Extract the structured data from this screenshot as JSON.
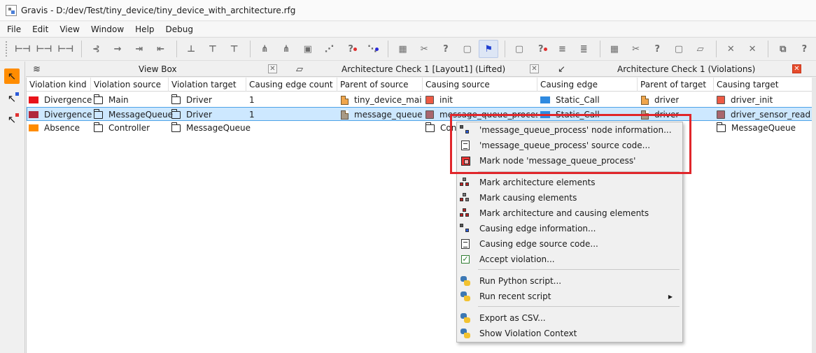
{
  "window": {
    "title": "Gravis - D:/dev/Test/tiny_device/tiny_device_with_architecture.rfg"
  },
  "menu": [
    "File",
    "Edit",
    "View",
    "Window",
    "Help",
    "Debug"
  ],
  "panels": {
    "view_box": {
      "title": "View Box"
    },
    "arch_check": {
      "title": "Architecture Check 1 [Layout1] (Lifted)"
    },
    "violations": {
      "title": "Architecture Check 1 (Violations)"
    }
  },
  "table": {
    "columns": [
      "Violation kind",
      "Violation source",
      "Violation target",
      "Causing edge count",
      "Parent of source",
      "Causing source",
      "Causing edge",
      "Parent of target",
      "Causing target"
    ],
    "rows": [
      {
        "kind": "Divergence",
        "kind_color": "#e8121a",
        "source": "Main",
        "target": "Driver",
        "count": "1",
        "parent_source": "tiny_device_main",
        "causing_source": "init",
        "edge": "Static_Call",
        "parent_target": "driver",
        "causing_target": "driver_init",
        "selected": false
      },
      {
        "kind": "Divergence",
        "kind_color": "#b0283c",
        "source": "MessageQueue",
        "target": "Driver",
        "count": "1",
        "parent_source": "message_queue",
        "causing_source": "message_queue_process",
        "edge": "Static_Call",
        "parent_target": "driver",
        "causing_target": "driver_sensor_read",
        "selected": true
      },
      {
        "kind": "Absence",
        "kind_color": "#ff8c00",
        "source": "Controller",
        "target": "MessageQueue",
        "count": "",
        "parent_source": "",
        "causing_source": "Con",
        "edge": "",
        "parent_target": "",
        "causing_target": "MessageQueue",
        "selected": false
      }
    ]
  },
  "colors": {
    "edge_blue": "#2f8ae0",
    "node_red": "#ee5a44",
    "node_mauve": "#a8666e",
    "file_orange": "#f0a64c",
    "highlight": "#e0262b"
  },
  "context_menu": {
    "items": [
      {
        "label": "'message_queue_process' node information...",
        "icon": "node-info-icon"
      },
      {
        "label": "'message_queue_process' source code...",
        "icon": "source-code-icon"
      },
      {
        "label": "Mark node 'message_queue_process'",
        "icon": "mark-node-icon"
      },
      {
        "label": "Mark architecture elements",
        "icon": "mark-architecture-icon"
      },
      {
        "label": "Mark causing elements",
        "icon": "mark-causing-icon"
      },
      {
        "label": "Mark architecture and causing elements",
        "icon": "mark-both-icon"
      },
      {
        "label": "Causing edge information...",
        "icon": "edge-info-icon"
      },
      {
        "label": "Causing edge source code...",
        "icon": "edge-source-icon"
      },
      {
        "label": "Accept violation...",
        "icon": "accept-icon"
      },
      {
        "label": "Run Python script...",
        "icon": "python-icon"
      },
      {
        "label": "Run recent script",
        "icon": "python-icon",
        "submenu": true
      },
      {
        "label": "Export as CSV...",
        "icon": "python-icon"
      },
      {
        "label": "Show Violation Context",
        "icon": "python-icon"
      }
    ]
  }
}
